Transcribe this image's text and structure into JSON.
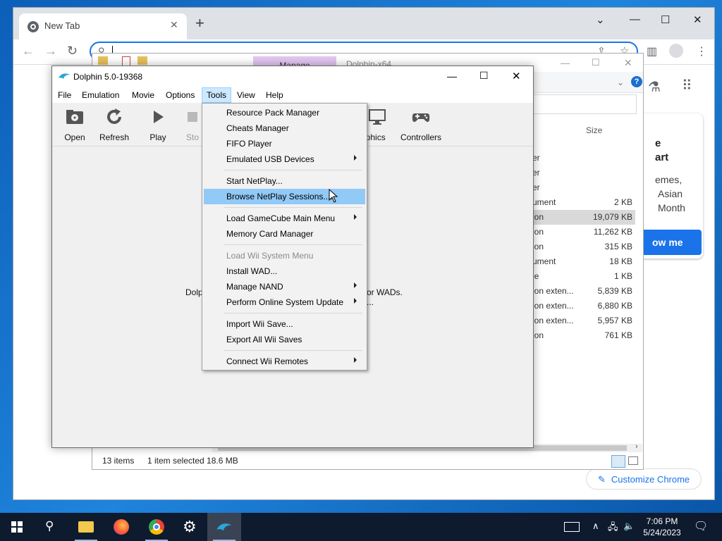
{
  "chrome": {
    "tab_title": "New Tab",
    "tab_close": "✕",
    "new_tab": "+",
    "customize_label": "Customize Chrome",
    "promo": {
      "line1": "e",
      "line2": "art",
      "line3": "emes,",
      "line4": "Asian",
      "line5": "Month",
      "button": "ow me"
    }
  },
  "explorer": {
    "manage_label": "Manage",
    "dolphin_label": "Dolphin-x64",
    "size_header": "Size",
    "rows": [
      {
        "type": "er",
        "size": ""
      },
      {
        "type": "er",
        "size": ""
      },
      {
        "type": "er",
        "size": ""
      },
      {
        "type": "ument",
        "size": "2 KB"
      },
      {
        "type": "ion",
        "size": "19,079 KB"
      },
      {
        "type": "ion",
        "size": "11,262 KB"
      },
      {
        "type": "ion",
        "size": "315 KB"
      },
      {
        "type": "ument",
        "size": "18 KB"
      },
      {
        "type": "le",
        "size": "1 KB"
      },
      {
        "type": "ion exten...",
        "size": "5,839 KB"
      },
      {
        "type": "ion exten...",
        "size": "6,880 KB"
      },
      {
        "type": "ion exten...",
        "size": "5,957 KB"
      },
      {
        "type": "ion",
        "size": "761 KB"
      }
    ],
    "status_items": "13 items",
    "status_selected": "1 item selected  18.6 MB"
  },
  "dolphin": {
    "title": "Dolphin 5.0-19368",
    "menus": [
      "File",
      "Emulation",
      "Movie",
      "Options",
      "Tools",
      "View",
      "Help"
    ],
    "toolbar": {
      "open": "Open",
      "refresh": "Refresh",
      "play": "Play",
      "stop": "Sto",
      "graphics": "aphics",
      "controllers": "Controllers"
    },
    "empty_left": "Dolp",
    "empty_right": "or WADs.",
    "empty_right2": "..."
  },
  "tools_menu": {
    "resource_pack": "Resource Pack Manager",
    "cheats": "Cheats Manager",
    "fifo": "FIFO Player",
    "usb": "Emulated USB Devices",
    "start_netplay": "Start NetPlay...",
    "browse_netplay": "Browse NetPlay Sessions....",
    "load_gc": "Load GameCube Main Menu",
    "memcard": "Memory Card Manager",
    "load_wii": "Load Wii System Menu",
    "install_wad": "Install WAD...",
    "manage_nand": "Manage NAND",
    "online_update": "Perform Online System Update",
    "import_save": "Import Wii Save...",
    "export_saves": "Export All Wii Saves",
    "connect_remotes": "Connect Wii Remotes"
  },
  "taskbar": {
    "time": "7:06 PM",
    "date": "5/24/2023"
  },
  "colors": {
    "highlight": "#91c9f7",
    "menu_open": "#cce8ff",
    "chrome_accent": "#1a73e8",
    "taskbar": "#0e1a2e"
  }
}
